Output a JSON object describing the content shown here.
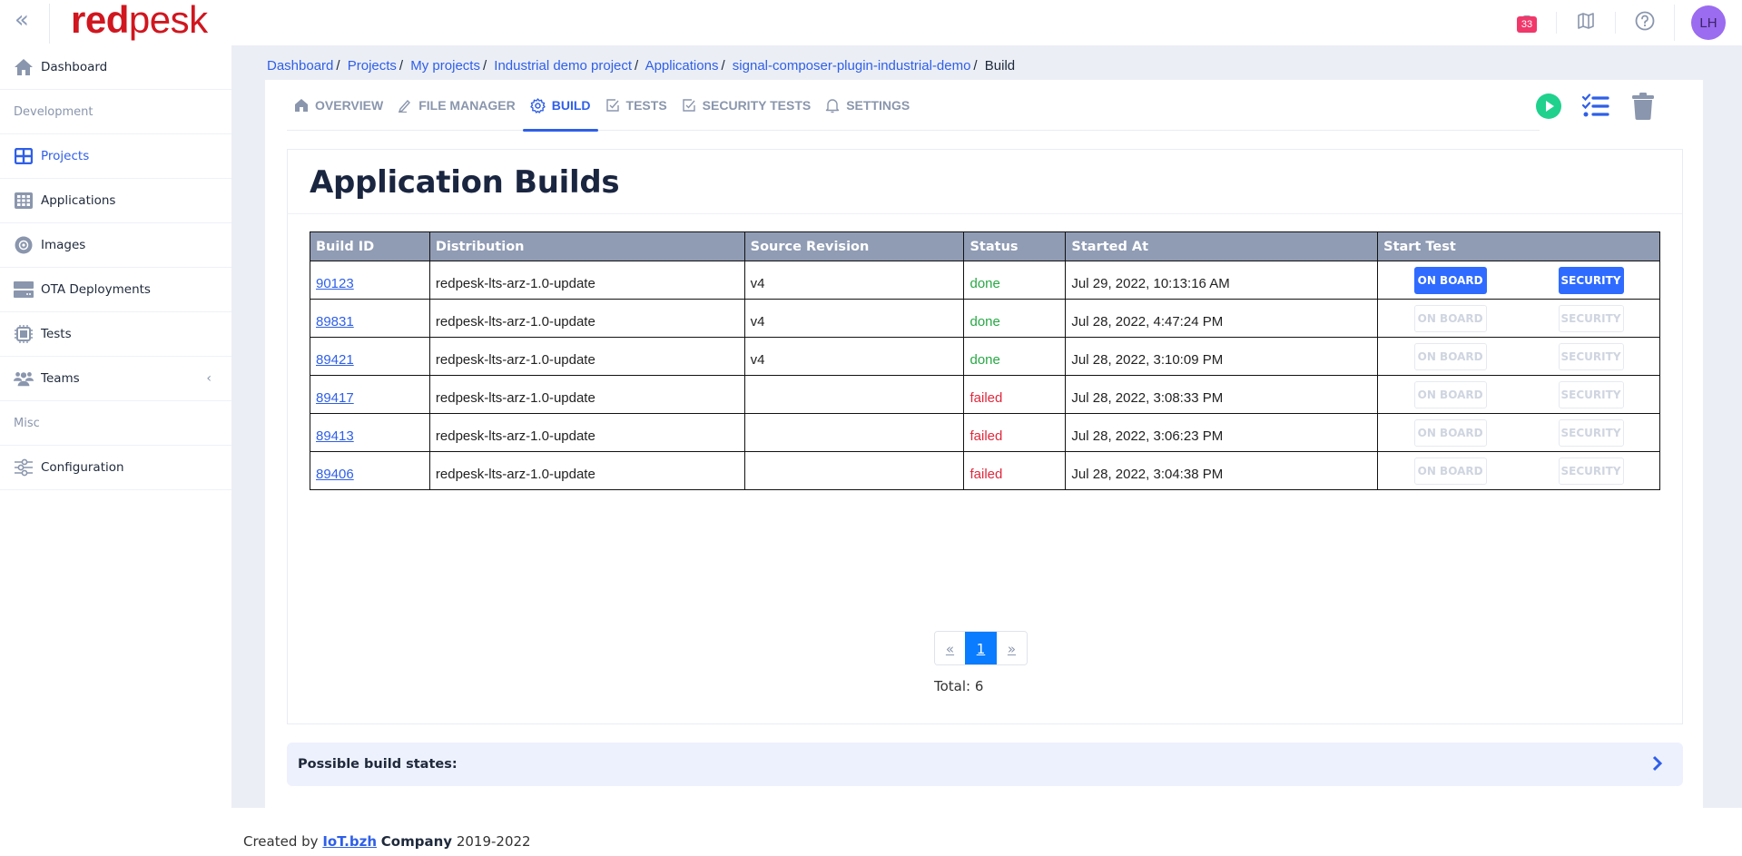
{
  "app": {
    "logo_bold": "red",
    "logo_light": "pesk"
  },
  "topbar": {
    "notification_count": "33",
    "avatar_initials": "LH",
    "icons": [
      "briefcase-icon",
      "book-icon",
      "help-icon"
    ]
  },
  "sidebar": {
    "items": [
      {
        "type": "link",
        "label": "Dashboard",
        "icon": "home-icon"
      },
      {
        "type": "header",
        "label": "Development"
      },
      {
        "type": "link",
        "label": "Projects",
        "icon": "grid-icon",
        "active": true
      },
      {
        "type": "link",
        "label": "Applications",
        "icon": "apps-icon"
      },
      {
        "type": "link",
        "label": "Images",
        "icon": "disc-icon"
      },
      {
        "type": "link",
        "label": "OTA Deployments",
        "icon": "server-icon"
      },
      {
        "type": "link",
        "label": "Tests",
        "icon": "chip-icon"
      },
      {
        "type": "link",
        "label": "Teams",
        "icon": "team-icon",
        "expandable": true
      },
      {
        "type": "header",
        "label": "Misc"
      },
      {
        "type": "link",
        "label": "Configuration",
        "icon": "sliders-icon"
      }
    ]
  },
  "breadcrumb": {
    "items": [
      "Dashboard",
      "Projects",
      "My projects",
      "Industrial demo project",
      "Applications",
      "signal-composer-plugin-industrial-demo"
    ],
    "current": "Build"
  },
  "tabs": [
    {
      "label": "OVERVIEW",
      "icon": "home-icon"
    },
    {
      "label": "FILE MANAGER",
      "icon": "pencil-icon"
    },
    {
      "label": "BUILD",
      "icon": "gear-icon",
      "active": true
    },
    {
      "label": "TESTS",
      "icon": "checkbox-icon"
    },
    {
      "label": "SECURITY TESTS",
      "icon": "checkbox-icon"
    },
    {
      "label": "SETTINGS",
      "icon": "bell-icon"
    }
  ],
  "actions": [
    "play-icon",
    "checklist-icon",
    "trash-icon"
  ],
  "page": {
    "title": "Application Builds"
  },
  "table": {
    "columns": [
      "Build ID",
      "Distribution",
      "Source Revision",
      "Status",
      "Started At",
      "Start Test"
    ],
    "button_labels": {
      "onboard": "ON BOARD",
      "security": "SECURITY"
    },
    "rows": [
      {
        "id": "90123",
        "distribution": "redpesk-lts-arz-1.0-update",
        "revision": "v4",
        "status": "done",
        "started": "Jul 29, 2022, 10:13:16 AM",
        "tests_enabled": true
      },
      {
        "id": "89831",
        "distribution": "redpesk-lts-arz-1.0-update",
        "revision": "v4",
        "status": "done",
        "started": "Jul 28, 2022, 4:47:24 PM",
        "tests_enabled": false
      },
      {
        "id": "89421",
        "distribution": "redpesk-lts-arz-1.0-update",
        "revision": "v4",
        "status": "done",
        "started": "Jul 28, 2022, 3:10:09 PM",
        "tests_enabled": false
      },
      {
        "id": "89417",
        "distribution": "redpesk-lts-arz-1.0-update",
        "revision": "",
        "status": "failed",
        "started": "Jul 28, 2022, 3:08:33 PM",
        "tests_enabled": false
      },
      {
        "id": "89413",
        "distribution": "redpesk-lts-arz-1.0-update",
        "revision": "",
        "status": "failed",
        "started": "Jul 28, 2022, 3:06:23 PM",
        "tests_enabled": false
      },
      {
        "id": "89406",
        "distribution": "redpesk-lts-arz-1.0-update",
        "revision": "",
        "status": "failed",
        "started": "Jul 28, 2022, 3:04:38 PM",
        "tests_enabled": false
      }
    ]
  },
  "pagination": {
    "prev": "«",
    "current": "1",
    "next": "»",
    "total_label": "Total: 6"
  },
  "states_panel": {
    "label": "Possible build states:"
  },
  "footer": {
    "prefix": "Created by",
    "link": "IoT.bzh",
    "company": "Company",
    "years": "2019-2022"
  },
  "colors": {
    "brand": "#d0161f",
    "accent": "#2f5fe8",
    "done": "#27a845",
    "failed": "#e0283c",
    "header_bg": "#909cb4"
  }
}
